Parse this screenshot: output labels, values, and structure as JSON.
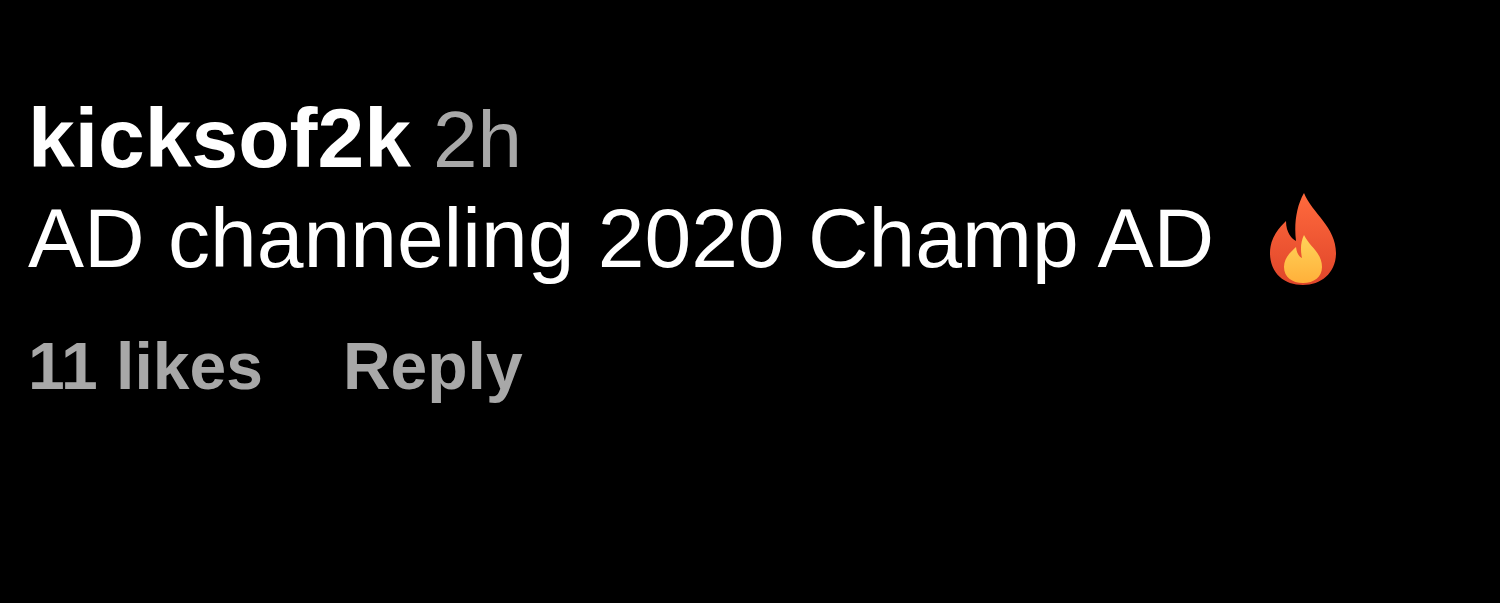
{
  "comment": {
    "username": "kicksof2k",
    "time": "2h",
    "text": "AD channeling 2020 Champ AD",
    "likes": "11 likes",
    "reply": "Reply"
  }
}
